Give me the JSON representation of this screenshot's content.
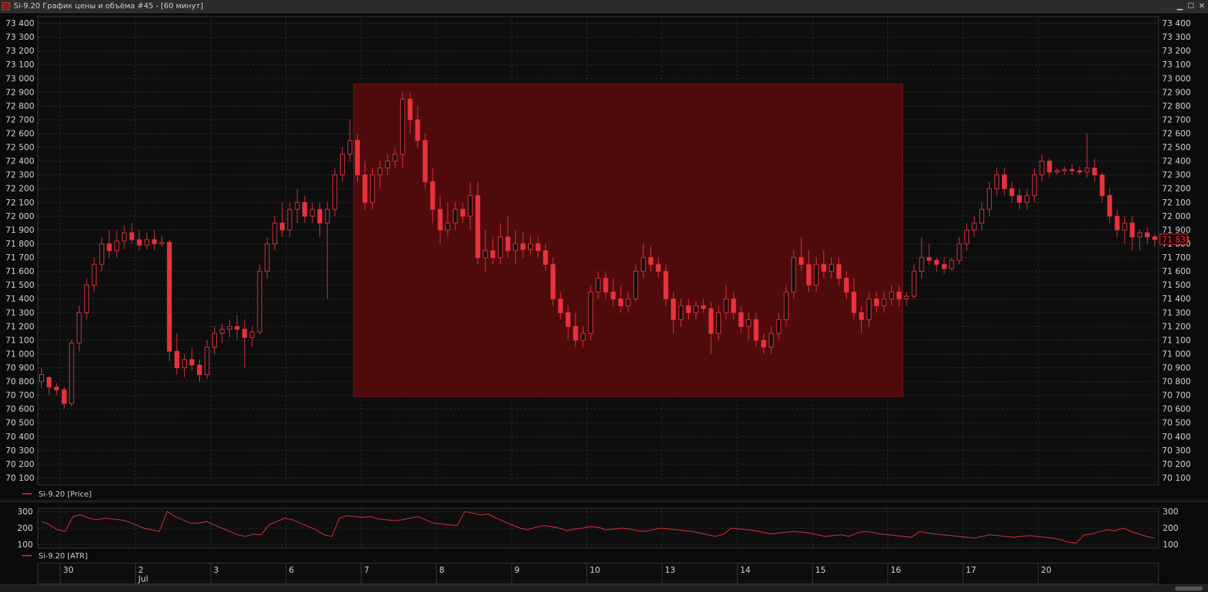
{
  "window": {
    "title": "Si-9.20 График цены и объёма #45 - [60 минут]",
    "minimize": "▁",
    "maximize": "☐",
    "close": "✕"
  },
  "colors": {
    "candle": "#e8323c",
    "highlight": "#5a0a0c",
    "grid": "#2e2e2e",
    "atr": "#e8323c",
    "last_price": "#e8323c"
  },
  "chart_data": [
    {
      "type": "candlestick",
      "legend": "Si-9.20 [Price]",
      "ylim": [
        70050,
        73450
      ],
      "yticks": [
        "70 100",
        "70 200",
        "70 300",
        "70 400",
        "70 500",
        "70 600",
        "70 700",
        "70 800",
        "70 900",
        "71 000",
        "71 100",
        "71 200",
        "71 300",
        "71 400",
        "71 500",
        "71 600",
        "71 700",
        "71 800",
        "71 900",
        "72 000",
        "72 100",
        "72 200",
        "72 300",
        "72 400",
        "72 500",
        "72 600",
        "72 700",
        "72 800",
        "72 900",
        "73 000",
        "73 100",
        "73 200",
        "73 300",
        "73 400"
      ],
      "last_price_label": "71 831",
      "highlight_box": {
        "x_from": 42,
        "x_to": 115,
        "y_from": 70690,
        "y_to": 72960
      },
      "candles": [
        [
          70800,
          70900,
          70750,
          70850
        ],
        [
          70830,
          70840,
          70700,
          70760
        ],
        [
          70760,
          70790,
          70700,
          70740
        ],
        [
          70740,
          70760,
          70600,
          70640
        ],
        [
          70640,
          71100,
          70620,
          71080
        ],
        [
          71080,
          71350,
          71020,
          71300
        ],
        [
          71300,
          71550,
          71250,
          71500
        ],
        [
          71500,
          71700,
          71450,
          71650
        ],
        [
          71650,
          71850,
          71600,
          71800
        ],
        [
          71800,
          71900,
          71700,
          71750
        ],
        [
          71750,
          71900,
          71700,
          71820
        ],
        [
          71820,
          71930,
          71760,
          71880
        ],
        [
          71880,
          71950,
          71800,
          71830
        ],
        [
          71830,
          71900,
          71750,
          71790
        ],
        [
          71790,
          71880,
          71760,
          71830
        ],
        [
          71830,
          71900,
          71750,
          71800
        ],
        [
          71800,
          71860,
          71780,
          71810
        ],
        [
          71810,
          71830,
          70950,
          71020
        ],
        [
          71020,
          71150,
          70850,
          70900
        ],
        [
          70900,
          71000,
          70830,
          70960
        ],
        [
          70960,
          71050,
          70880,
          70920
        ],
        [
          70920,
          70960,
          70800,
          70850
        ],
        [
          70850,
          71100,
          70820,
          71050
        ],
        [
          71050,
          71200,
          71000,
          71150
        ],
        [
          71150,
          71220,
          71080,
          71180
        ],
        [
          71180,
          71250,
          71120,
          71200
        ],
        [
          71200,
          71280,
          71100,
          71180
        ],
        [
          71180,
          71250,
          70900,
          71120
        ],
        [
          71120,
          71200,
          71050,
          71160
        ],
        [
          71160,
          71650,
          71140,
          71600
        ],
        [
          71600,
          71850,
          71550,
          71800
        ],
        [
          71800,
          72000,
          71750,
          71950
        ],
        [
          71950,
          72100,
          71850,
          71900
        ],
        [
          71900,
          72100,
          71850,
          72050
        ],
        [
          72050,
          72200,
          71950,
          72100
        ],
        [
          72100,
          72150,
          71950,
          72000
        ],
        [
          72000,
          72100,
          71950,
          72050
        ],
        [
          72050,
          72100,
          71850,
          71950
        ],
        [
          71950,
          72100,
          71400,
          72050
        ],
        [
          72050,
          72350,
          72000,
          72300
        ],
        [
          72300,
          72500,
          72250,
          72450
        ],
        [
          72450,
          72700,
          72400,
          72550
        ],
        [
          72550,
          72600,
          72250,
          72300
        ],
        [
          72300,
          72400,
          72050,
          72100
        ],
        [
          72100,
          72350,
          72050,
          72300
        ],
        [
          72300,
          72400,
          72200,
          72350
        ],
        [
          72350,
          72450,
          72300,
          72400
        ],
        [
          72400,
          72500,
          72350,
          72450
        ],
        [
          72450,
          72900,
          72350,
          72850
        ],
        [
          72850,
          72900,
          72600,
          72700
        ],
        [
          72700,
          72800,
          72500,
          72550
        ],
        [
          72550,
          72600,
          72200,
          72250
        ],
        [
          72250,
          72350,
          71950,
          72050
        ],
        [
          72050,
          72150,
          71800,
          71900
        ],
        [
          71900,
          72100,
          71850,
          71950
        ],
        [
          71950,
          72100,
          71900,
          72050
        ],
        [
          72050,
          72100,
          71950,
          72000
        ],
        [
          72000,
          72250,
          71900,
          72150
        ],
        [
          72150,
          72250,
          71650,
          71700
        ],
        [
          71700,
          71900,
          71600,
          71750
        ],
        [
          71750,
          71850,
          71650,
          71700
        ],
        [
          71700,
          71950,
          71650,
          71850
        ],
        [
          71850,
          72000,
          71700,
          71750
        ],
        [
          71750,
          71900,
          71650,
          71800
        ],
        [
          71800,
          71880,
          71700,
          71760
        ],
        [
          71760,
          71860,
          71720,
          71800
        ],
        [
          71800,
          71850,
          71700,
          71750
        ],
        [
          71750,
          71800,
          71600,
          71650
        ],
        [
          71650,
          71700,
          71350,
          71400
        ],
        [
          71400,
          71450,
          71250,
          71300
        ],
        [
          71300,
          71350,
          71100,
          71200
        ],
        [
          71200,
          71300,
          71050,
          71100
        ],
        [
          71100,
          71200,
          71050,
          71150
        ],
        [
          71150,
          71500,
          71100,
          71450
        ],
        [
          71450,
          71600,
          71400,
          71550
        ],
        [
          71550,
          71600,
          71400,
          71450
        ],
        [
          71450,
          71550,
          71350,
          71400
        ],
        [
          71400,
          71500,
          71300,
          71350
        ],
        [
          71350,
          71450,
          71300,
          71400
        ],
        [
          71400,
          71650,
          71380,
          71600
        ],
        [
          71600,
          71800,
          71550,
          71700
        ],
        [
          71700,
          71780,
          71600,
          71650
        ],
        [
          71650,
          71700,
          71550,
          71600
        ],
        [
          71600,
          71650,
          71350,
          71400
        ],
        [
          71400,
          71450,
          71150,
          71250
        ],
        [
          71250,
          71400,
          71200,
          71350
        ],
        [
          71350,
          71400,
          71250,
          71300
        ],
        [
          71300,
          71380,
          71250,
          71350
        ],
        [
          71350,
          71400,
          71300,
          71330
        ],
        [
          71330,
          71380,
          71000,
          71150
        ],
        [
          71150,
          71350,
          71100,
          71300
        ],
        [
          71300,
          71500,
          71250,
          71400
        ],
        [
          71400,
          71450,
          71250,
          71300
        ],
        [
          71300,
          71350,
          71150,
          71200
        ],
        [
          71200,
          71300,
          71100,
          71250
        ],
        [
          71250,
          71300,
          71050,
          71100
        ],
        [
          71100,
          71150,
          71000,
          71050
        ],
        [
          71050,
          71200,
          71000,
          71150
        ],
        [
          71150,
          71300,
          71100,
          71250
        ],
        [
          71250,
          71500,
          71200,
          71450
        ],
        [
          71450,
          71750,
          71400,
          71700
        ],
        [
          71700,
          71850,
          71600,
          71650
        ],
        [
          71650,
          71750,
          71450,
          71500
        ],
        [
          71500,
          71700,
          71450,
          71650
        ],
        [
          71650,
          71750,
          71550,
          71600
        ],
        [
          71600,
          71700,
          71550,
          71650
        ],
        [
          71650,
          71700,
          71500,
          71550
        ],
        [
          71550,
          71600,
          71400,
          71450
        ],
        [
          71450,
          71550,
          71250,
          71300
        ],
        [
          71300,
          71350,
          71150,
          71250
        ],
        [
          71250,
          71450,
          71200,
          71400
        ],
        [
          71400,
          71450,
          71300,
          71350
        ],
        [
          71350,
          71450,
          71300,
          71400
        ],
        [
          71400,
          71500,
          71350,
          71450
        ],
        [
          71450,
          71500,
          71350,
          71400
        ],
        [
          71400,
          71450,
          71350,
          71420
        ],
        [
          71420,
          71650,
          71400,
          71600
        ],
        [
          71600,
          71850,
          71550,
          71700
        ],
        [
          71700,
          71800,
          71650,
          71680
        ],
        [
          71680,
          71700,
          71600,
          71650
        ],
        [
          71650,
          71700,
          71580,
          71620
        ],
        [
          71620,
          71700,
          71600,
          71680
        ],
        [
          71680,
          71850,
          71650,
          71800
        ],
        [
          71800,
          71950,
          71750,
          71900
        ],
        [
          71900,
          72000,
          71850,
          71950
        ],
        [
          71950,
          72100,
          71900,
          72050
        ],
        [
          72050,
          72250,
          72000,
          72200
        ],
        [
          72200,
          72350,
          72150,
          72300
        ],
        [
          72300,
          72350,
          72150,
          72200
        ],
        [
          72200,
          72250,
          72100,
          72150
        ],
        [
          72150,
          72200,
          72050,
          72100
        ],
        [
          72100,
          72200,
          72050,
          72150
        ],
        [
          72150,
          72350,
          72100,
          72300
        ],
        [
          72300,
          72450,
          72250,
          72400
        ],
        [
          72400,
          72420,
          72280,
          72320
        ],
        [
          72320,
          72350,
          72300,
          72330
        ],
        [
          72330,
          72360,
          72300,
          72340
        ],
        [
          72340,
          72380,
          72300,
          72330
        ],
        [
          72330,
          72360,
          72300,
          72320
        ],
        [
          72320,
          72600,
          72280,
          72350
        ],
        [
          72350,
          72420,
          72250,
          72300
        ],
        [
          72300,
          72320,
          72100,
          72150
        ],
        [
          72150,
          72200,
          71950,
          72000
        ],
        [
          72000,
          72050,
          71850,
          71900
        ],
        [
          71900,
          72000,
          71800,
          71950
        ],
        [
          71950,
          72000,
          71750,
          71850
        ],
        [
          71850,
          71900,
          71750,
          71880
        ],
        [
          71880,
          71920,
          71800,
          71850
        ],
        [
          71850,
          71870,
          71780,
          71831
        ]
      ],
      "x_day_labels": [
        {
          "bar": 3,
          "label": "30"
        },
        {
          "bar": 13,
          "label": "2"
        },
        {
          "bar": 23,
          "label": "3"
        },
        {
          "bar": 33,
          "label": "6"
        },
        {
          "bar": 43,
          "label": "7"
        },
        {
          "bar": 53,
          "label": "8"
        },
        {
          "bar": 63,
          "label": "9"
        },
        {
          "bar": 73,
          "label": "10"
        },
        {
          "bar": 83,
          "label": "13"
        },
        {
          "bar": 93,
          "label": "14"
        },
        {
          "bar": 103,
          "label": "15"
        },
        {
          "bar": 113,
          "label": "16"
        },
        {
          "bar": 123,
          "label": "17"
        },
        {
          "bar": 133,
          "label": "20"
        }
      ],
      "x_month_labels": [
        {
          "bar": 13,
          "label": "Jul"
        }
      ]
    },
    {
      "type": "line",
      "legend": "Si-9.20 [ATR]",
      "ylim": [
        80,
        320
      ],
      "yticks": [
        "100",
        "200",
        "300"
      ],
      "values": [
        240,
        220,
        190,
        180,
        270,
        280,
        260,
        250,
        260,
        255,
        250,
        240,
        220,
        200,
        190,
        180,
        300,
        270,
        250,
        230,
        230,
        240,
        220,
        200,
        180,
        160,
        150,
        165,
        160,
        220,
        240,
        260,
        250,
        230,
        210,
        190,
        160,
        150,
        260,
        275,
        270,
        265,
        270,
        255,
        250,
        245,
        250,
        260,
        270,
        250,
        230,
        225,
        220,
        215,
        300,
        290,
        280,
        285,
        260,
        240,
        220,
        200,
        190,
        205,
        215,
        210,
        200,
        185,
        195,
        200,
        210,
        205,
        190,
        195,
        200,
        195,
        185,
        180,
        190,
        200,
        195,
        190,
        185,
        180,
        170,
        160,
        150,
        165,
        200,
        195,
        190,
        185,
        175,
        165,
        170,
        175,
        180,
        175,
        170,
        160,
        150,
        155,
        160,
        150,
        170,
        180,
        175,
        165,
        160,
        155,
        150,
        145,
        180,
        170,
        165,
        160,
        155,
        150,
        145,
        140,
        150,
        160,
        155,
        150,
        145,
        150,
        155,
        150,
        145,
        140,
        130,
        115,
        110,
        160,
        165,
        180,
        190,
        185,
        200,
        180,
        165,
        150,
        140
      ]
    }
  ]
}
